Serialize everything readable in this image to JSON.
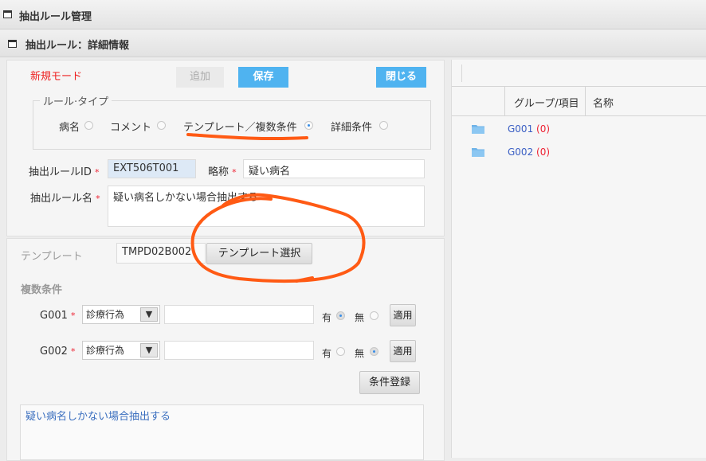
{
  "window": {
    "title": "抽出ルール管理"
  },
  "subheader": {
    "title": "抽出ルール：詳細情報"
  },
  "mode_label": "新規モード",
  "toolbar": {
    "add_label": "追加",
    "save_label": "保存",
    "close_label": "閉じる"
  },
  "rule_type": {
    "legend": "ルール·タイプ",
    "options": [
      {
        "label": "病名",
        "checked": false
      },
      {
        "label": "コメント",
        "checked": false
      },
      {
        "label": "テンプレート／複数条件",
        "checked": true
      },
      {
        "label": "詳細条件",
        "checked": false
      }
    ]
  },
  "rule_id": {
    "label": "抽出ルールID",
    "value": "EXT506T001"
  },
  "abbrev": {
    "label": "略称",
    "value": "疑い病名"
  },
  "rule_name": {
    "label": "抽出ルール名",
    "value": "疑い病名しかない場合抽出する"
  },
  "template": {
    "label": "テンプレート",
    "value": "TMPD02B002",
    "select_button": "テンプレート選択"
  },
  "multi_condition": {
    "label": "複数条件",
    "rows": [
      {
        "group": "G001",
        "select_value": "診療行為",
        "text_value": "",
        "yes_label": "有",
        "no_label": "無",
        "selected": "yes",
        "apply_label": "適用"
      },
      {
        "group": "G002",
        "select_value": "診療行為",
        "text_value": "",
        "yes_label": "有",
        "no_label": "無",
        "selected": "no",
        "apply_label": "適用"
      }
    ],
    "register_label": "条件登録"
  },
  "description": {
    "value": "疑い病名しかない場合抽出する"
  },
  "tree": {
    "columns": [
      "グループ/項目",
      "名称"
    ],
    "items": [
      {
        "id": "G001",
        "count": "(0)"
      },
      {
        "id": "G002",
        "count": "(0)"
      }
    ]
  },
  "colors": {
    "accent": "#4fb3f0",
    "annotation": "#ff5a14",
    "required": "#e22233",
    "link": "#3b5fc4"
  },
  "icons": {
    "window": "window-icon",
    "folder": "folder-icon",
    "dropdown": "chevron-down-icon"
  }
}
